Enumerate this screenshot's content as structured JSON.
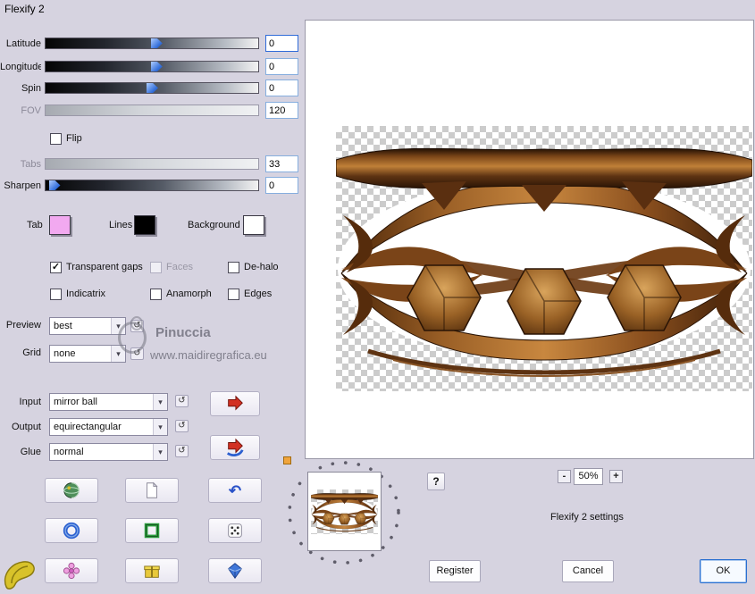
{
  "window": {
    "title": "Flexify 2"
  },
  "sliders": [
    {
      "label": "Latitude",
      "value": "0",
      "thumb": "52%"
    },
    {
      "label": "Longitude",
      "value": "0",
      "thumb": "52%"
    },
    {
      "label": "Spin",
      "value": "0",
      "thumb": "50%"
    },
    {
      "label": "FOV",
      "value": "120"
    },
    {
      "label": "Tabs",
      "value": "33"
    },
    {
      "label": "Sharpen",
      "value": "0",
      "thumb": "4%"
    }
  ],
  "flip": {
    "label": "Flip",
    "checked": false
  },
  "swatches": {
    "tab": {
      "label": "Tab",
      "color": "#f2a9f0"
    },
    "lines": {
      "label": "Lines",
      "color": "#000000"
    },
    "background": {
      "label": "Background",
      "color": "#ffffff"
    }
  },
  "checkboxes": [
    {
      "label": "Transparent gaps",
      "checked": true,
      "disabled": false
    },
    {
      "label": "Faces",
      "checked": false,
      "disabled": true
    },
    {
      "label": "De-halo",
      "checked": false,
      "disabled": false
    },
    {
      "label": "Indicatrix",
      "checked": false,
      "disabled": false
    },
    {
      "label": "Anamorph",
      "checked": false,
      "disabled": false
    },
    {
      "label": "Edges",
      "checked": false,
      "disabled": false
    }
  ],
  "dropdowns": {
    "preview": {
      "label": "Preview",
      "value": "best"
    },
    "grid": {
      "label": "Grid",
      "value": "none"
    },
    "input": {
      "label": "Input",
      "value": "mirror ball"
    },
    "output": {
      "label": "Output",
      "value": "equirectangular"
    },
    "glue": {
      "label": "Glue",
      "value": "normal"
    }
  },
  "watermark": {
    "name": "Pinuccia",
    "url": "www.maidiregrafica.eu"
  },
  "zoom": {
    "minus": "-",
    "value": "50%",
    "plus": "+"
  },
  "help_label": "?",
  "status_text": "Flexify 2 settings",
  "action_buttons": {
    "register": "Register",
    "cancel": "Cancel",
    "ok": "OK"
  },
  "icons": {
    "chevron_down": "▾",
    "reset": "↺",
    "undo": "↶",
    "check": "✓"
  },
  "colors": {
    "dialog_bg": "#d6d3e0",
    "accent_blue": "#2f6bd8",
    "wood_dark": "#2a1405",
    "wood_mid": "#8a5425",
    "wood_light": "#c8873f"
  }
}
